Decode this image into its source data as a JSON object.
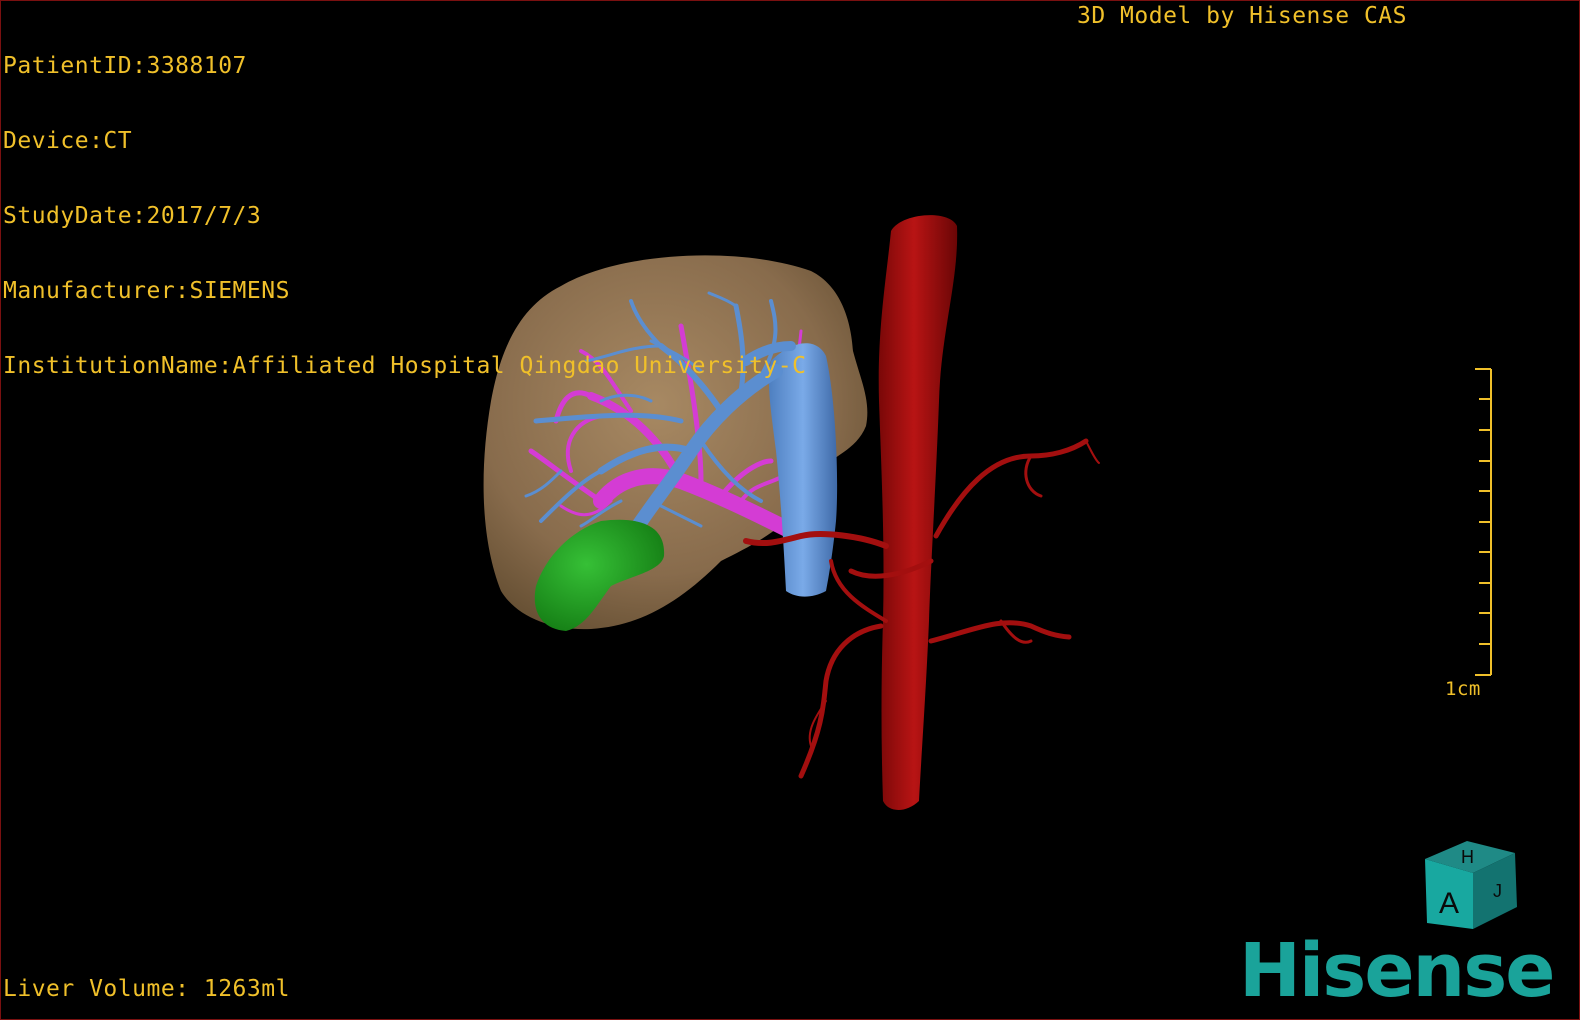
{
  "overlay": {
    "patient_id": "PatientID:3388107",
    "device": "Device:CT",
    "study_date": "StudyDate:2017/7/3",
    "manufacturer": "Manufacturer:SIEMENS",
    "institution": "InstitutionName:Affiliated Hospital Qingdao University-C",
    "model_credit": "3D Model by Hisense CAS",
    "liver_volume": "Liver Volume: 1263ml"
  },
  "scale_bar": {
    "label": "1cm"
  },
  "orientation_cube": {
    "top_letter": "H",
    "front_letter": "A",
    "side_letter": "J"
  },
  "logo": {
    "text": "Hisense"
  },
  "colors": {
    "overlay_text": "#f0c02a",
    "liver": "#9a7a52",
    "portal_vein": "#5b8ed0",
    "hepatic_vein": "#d43cd4",
    "gallbladder": "#1f9c1f",
    "aorta": "#a30f0f",
    "logo": "#1aa39a"
  }
}
